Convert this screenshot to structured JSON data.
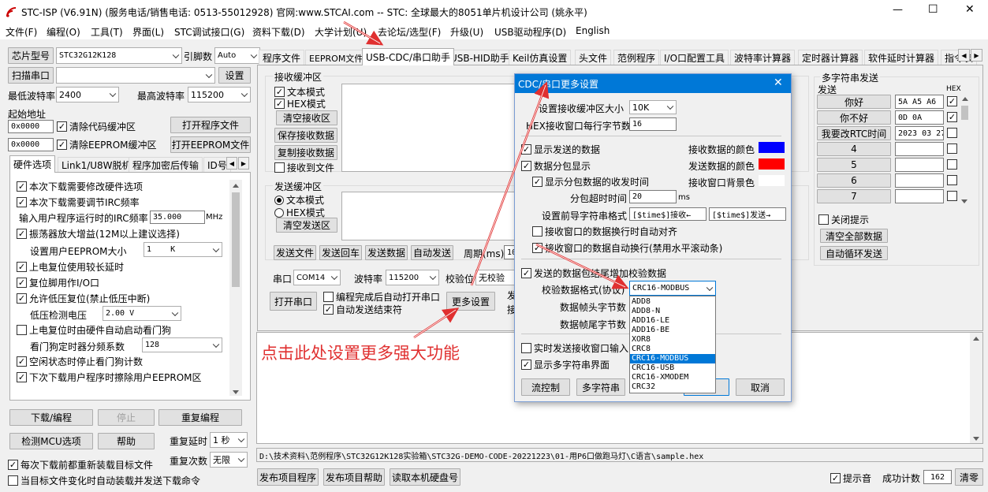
{
  "window": {
    "title": "STC-ISP (V6.91N) (服务电话/销售电话: 0513-55012928) 官网:www.STCAI.com  -- STC: 全球最大的8051单片机设计公司 (姚永平)",
    "controls": {
      "minimize": "—",
      "maximize": "☐",
      "close": "✕"
    }
  },
  "menu": [
    "文件(F)",
    "编程(O)",
    "工具(T)",
    "界面(L)",
    "STC调试接口(G)",
    "资料下载(D)",
    "大学计划(U)",
    "去论坛/选型(F)",
    "升级(U)",
    "USB驱动程序(D)",
    "English"
  ],
  "left": {
    "chip_btn": "芯片型号",
    "chip_value": "STC32G12K128",
    "pin_label": "引脚数",
    "pin_value": "Auto",
    "scan_btn": "扫描串口",
    "set_btn": "设置",
    "min_baud_label": "最低波特率",
    "min_baud_value": "2400",
    "max_baud_label": "最高波特率",
    "max_baud_value": "115200",
    "start_addr_label": "起始地址",
    "addr1": "0x0000",
    "clear_code": "清除代码缓冲区",
    "open_prog": "打开程序文件",
    "addr2": "0x0000",
    "clear_eeprom": "清除EEPROM缓冲区",
    "open_eeprom": "打开EEPROM文件",
    "tabs": [
      "硬件选项",
      "Link1/U8W脱机",
      "程序加密后传输",
      "ID号"
    ],
    "options": [
      {
        "text": "本次下载需要修改硬件选项",
        "checked": true
      },
      {
        "text": "本次下载需要调节IRC频率",
        "checked": true
      },
      {
        "text": "输入用户程序运行时的IRC频率",
        "checked": null,
        "value": "35.000",
        "unit": "MHz"
      },
      {
        "text": "振荡器放大增益(12M以上建议选择)",
        "checked": true
      },
      {
        "text": "设置用户EEPROM大小",
        "checked": null,
        "value": "1    K"
      },
      {
        "text": "上电复位使用较长延时",
        "checked": true
      },
      {
        "text": "复位脚用作I/O口",
        "checked": true
      },
      {
        "text": "允许低压复位(禁止低压中断)",
        "checked": true
      },
      {
        "text": "低压检测电压",
        "checked": null,
        "value": "2.00 V"
      },
      {
        "text": "上电复位时由硬件自动启动看门狗",
        "checked": false
      },
      {
        "text": "看门狗定时器分频系数",
        "checked": null,
        "value": "128"
      },
      {
        "text": "空闲状态时停止看门狗计数",
        "checked": true
      },
      {
        "text": "下次下载用户程序时擦除用户EEPROM区",
        "checked": true
      }
    ],
    "download_btn": "下载/编程",
    "stop_btn": "停止",
    "reprogram_btn": "重复编程",
    "check_mcu_btn": "检测MCU选项",
    "help_btn": "帮助",
    "repeat_delay_label": "重复延时",
    "repeat_delay_value": "1 秒",
    "repeat_count_label": "重复次数",
    "repeat_count_value": "无限",
    "reload_each": "每次下载前都重新装载目标文件",
    "auto_send": "当目标文件变化时自动装载并发送下载命令"
  },
  "main_tabs": [
    "程序文件",
    "EEPROM文件",
    "USB-CDC/串口助手",
    "USB-HID助手",
    "Keil仿真设置",
    "头文件",
    "范例程序",
    "I/O口配置工具",
    "波特率计算器",
    "定时器计算器",
    "软件延时计算器",
    "指令表"
  ],
  "serial": {
    "recv_title": "接收缓冲区",
    "text_mode": "文本模式",
    "hex_mode": "HEX模式",
    "clear_recv": "清空接收区",
    "save_recv": "保存接收数据",
    "copy_recv": "复制接收数据",
    "recv_to_file": "接收到文件",
    "send_title": "发送缓冲区",
    "send_text_mode": "文本模式",
    "send_hex_mode": "HEX模式",
    "clear_send": "清空发送区",
    "send_file": "发送文件",
    "send_return": "发送回车",
    "send_data": "发送数据",
    "auto_send": "自动发送",
    "period_label": "周期(ms)",
    "period_value": "10",
    "port_label": "串口",
    "port_value": "COM14",
    "baud_label": "波特率",
    "baud_value": "115200",
    "parity_label": "校验位",
    "parity_value": "无校验",
    "open_port": "打开串口",
    "auto_open": "编程完成后自动打开串口",
    "auto_send_end": "自动发送结束符",
    "more_settings": "更多设置",
    "extra_1": "发",
    "extra_2": "接"
  },
  "multi_send": {
    "title": "多字符串发送",
    "send_label": "发送",
    "hex_label": "HEX",
    "rows": [
      {
        "btn": "你好",
        "value": "5A A5 A6",
        "hex": true
      },
      {
        "btn": "你不好",
        "value": "0D 0A",
        "hex": true
      },
      {
        "btn": "我要改RTC时间",
        "value": "2023 03 27",
        "hex": false
      },
      {
        "btn": "4",
        "value": "",
        "hex": false
      },
      {
        "btn": "5",
        "value": "",
        "hex": false
      },
      {
        "btn": "6",
        "value": "",
        "hex": false
      },
      {
        "btn": "7",
        "value": "",
        "hex": false
      }
    ],
    "close_tip": "关闭提示",
    "clear_all": "清空全部数据",
    "auto_loop": "自动循环发送"
  },
  "annotation": "点击此处设置更多强大功能",
  "path": "D:\\技术资料\\范例程序\\STC32G12K128实验箱\\STC32G-DEMO-CODE-20221223\\01-用P6口做跑马灯\\C语言\\sample.hex",
  "bottom": {
    "publish_prog": "发布项目程序",
    "publish_help": "发布项目帮助",
    "read_disk": "读取本机硬盘号",
    "beep": "提示音",
    "success_label": "成功计数",
    "success_value": "162",
    "clear": "清零"
  },
  "dialog": {
    "title": "CDC/串口更多设置",
    "close": "✕",
    "recv_buf_label": "设置接收缓冲区大小",
    "recv_buf_value": "10K",
    "hex_bytes_label": "HEX接收窗口每行字节数",
    "hex_bytes_value": "16",
    "show_sent": "显示发送的数据",
    "recv_color_label": "接收数据的颜色",
    "packet_show": "数据分包显示",
    "send_color_label": "发送数据的颜色",
    "show_time": "显示分包数据的收发时间",
    "recv_bg_label": "接收窗口背景色",
    "timeout_label": "分包超时时间",
    "timeout_value": "20",
    "timeout_unit": "ms",
    "prefix_label": "设置前导字符串格式",
    "prefix_recv": "[$time$]接收←",
    "prefix_send": "[$time$]发送→",
    "auto_align": "接收窗口的数据换行时自动对齐",
    "auto_wrap": "接收窗口的数据自动换行(禁用水平滚动条)",
    "add_check": "发送的数据包结尾增加校验数据",
    "check_format_label": "校验数据格式(协议)",
    "check_format_value": "CRC16-MODBUS",
    "frame_head_label": "数据帧头字节数",
    "frame_tail_label": "数据帧尾字节数",
    "dropdown": [
      "ADD8",
      "ADD8-N",
      "ADD16-LE",
      "ADD16-BE",
      "XOR8",
      "CRC8",
      "CRC16-MODBUS",
      "CRC16-USB",
      "CRC16-XMODEM",
      "CRC32"
    ],
    "dropdown_selected": "CRC16-MODBUS",
    "realtime_send": "实时发送接收窗口输入",
    "show_multi": "显示多字符串界面",
    "flow_ctrl": "流控制",
    "multi_str": "多字符串",
    "cancel": "取消",
    "colors": {
      "recv": "#0000ff",
      "send": "#ff0000",
      "bg": "#ffffff"
    }
  },
  "colors": {
    "accent": "#0078d7",
    "annotation": "#e03030"
  }
}
